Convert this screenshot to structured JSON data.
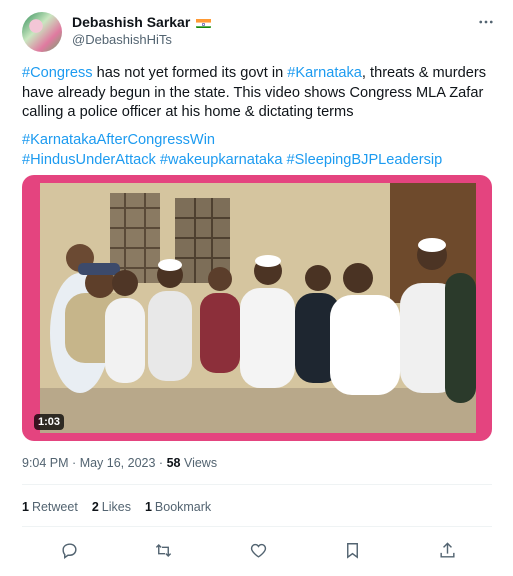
{
  "author": {
    "display_name": "Debashish Sarkar",
    "handle": "@DebashishHiTs",
    "flag_icon": "india-flag-icon"
  },
  "body": {
    "line_segments": [
      {
        "text": "#Congress",
        "tag": true
      },
      {
        "text": " has not yet formed its govt in ",
        "tag": false
      },
      {
        "text": "#Karnataka",
        "tag": true
      },
      {
        "text": ", threats & murders have already begun in the state. This video shows Congress MLA Zafar calling a police officer at his home & dictating terms",
        "tag": false
      }
    ],
    "hashtags_line1": [
      "#KarnatakaAfterCongressWin"
    ],
    "hashtags_line2": [
      "#HindusUnderAttack",
      "#wakeupkarnataka",
      "#SleepingBJPLeadersip"
    ]
  },
  "media": {
    "duration": "1:03"
  },
  "meta": {
    "time": "9:04 PM",
    "date": "May 16, 2023",
    "views_count": "58",
    "views_label": "Views"
  },
  "stats": {
    "retweets_count": "1",
    "retweets_label": "Retweet",
    "likes_count": "2",
    "likes_label": "Likes",
    "bookmarks_count": "1",
    "bookmarks_label": "Bookmark"
  },
  "colors": {
    "accent": "#1d9bf0",
    "media_border": "#e4447f",
    "secondary_text": "#536471"
  }
}
